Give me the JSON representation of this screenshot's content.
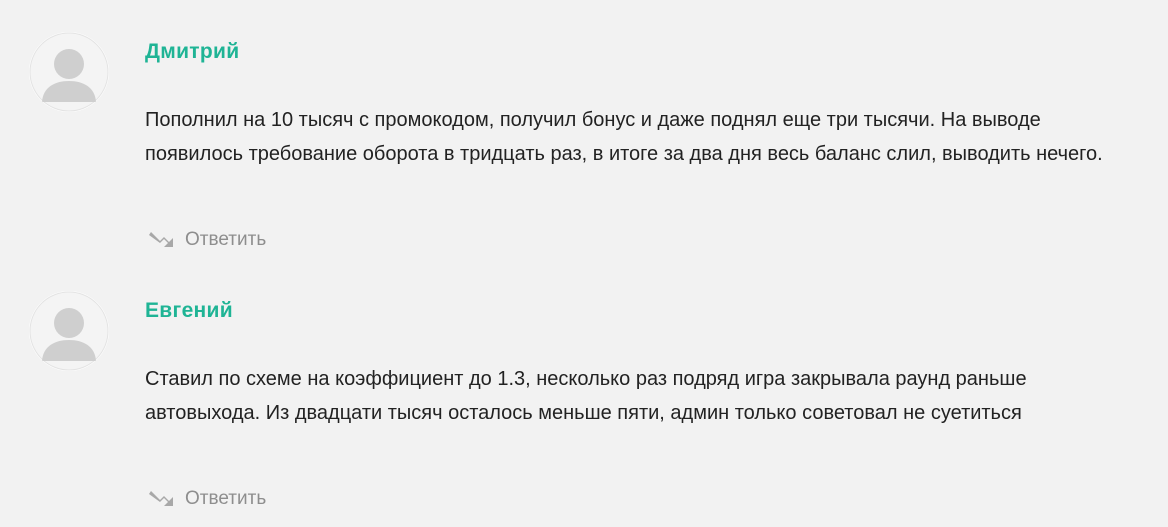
{
  "colors": {
    "author": "#1fb495",
    "reply_icon": "#a8a8a8",
    "reply_text": "#8e8e8e",
    "avatar_silhouette": "#cfcfcf"
  },
  "comments": [
    {
      "author": "Дмитрий",
      "text": "Пополнил на 10 тысяч с промокодом, получил бонус и даже поднял еще три тысячи. На выводе появилось требование оборота в тридцать раз, в итоге за два дня весь баланс слил, выводить нечего.",
      "reply_label": "Ответить",
      "avatar_icon": "user-avatar-icon",
      "reply_icon": "reply-arrow-icon"
    },
    {
      "author": "Евгений",
      "text": "Ставил по схеме на коэффициент до 1.3, несколько раз подряд игра закрывала раунд раньше автовыхода. Из двадцати тысяч осталось меньше пяти, админ только советовал не суетиться",
      "reply_label": "Ответить",
      "avatar_icon": "user-avatar-icon",
      "reply_icon": "reply-arrow-icon"
    }
  ]
}
